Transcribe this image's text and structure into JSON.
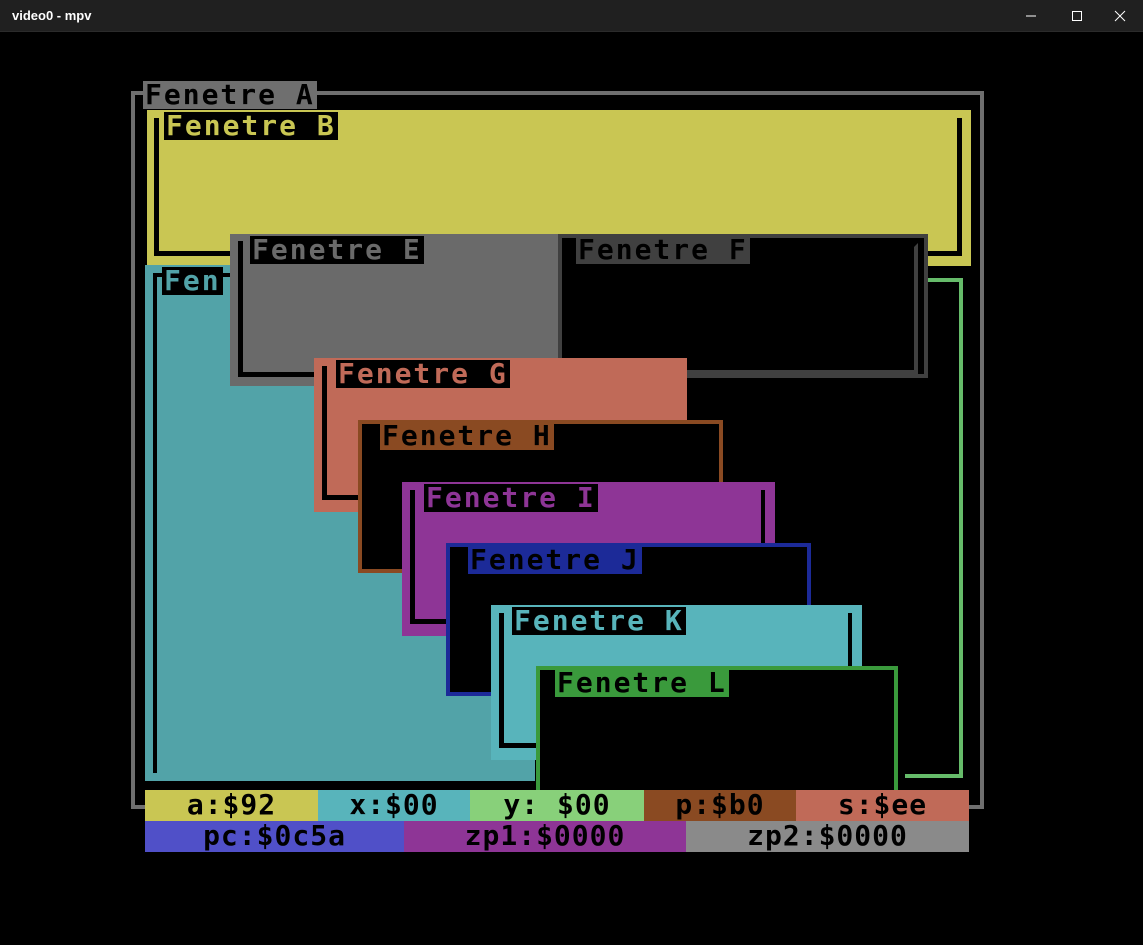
{
  "window": {
    "title": "video0 - mpv"
  },
  "colors": {
    "A": "#6f6f6f",
    "B": "#c9c653",
    "C": "#52a3a8",
    "E": "#6a6a6a",
    "F": "#404040",
    "G": "#c06a58",
    "H": "#8a4a22",
    "I": "#8e3596",
    "J": "#1c2a98",
    "K": "#58b4bb",
    "L": "#3a9a3c",
    "right_green": "#66bb6a"
  },
  "windows": {
    "A": {
      "title": "Fenetre A"
    },
    "B": {
      "title": "Fenetre B"
    },
    "C": {
      "title": "Fen"
    },
    "E": {
      "title": "Fenetre E"
    },
    "F": {
      "title": "Fenetre F"
    },
    "G": {
      "title": "Fenetre G"
    },
    "H": {
      "title": "Fenetre H"
    },
    "I": {
      "title": "Fenetre I"
    },
    "J": {
      "title": "Fenetre J"
    },
    "K": {
      "title": "Fenetre K"
    },
    "L": {
      "title": "Fenetre L"
    }
  },
  "registers": {
    "a": "a:$92",
    "x": "x:$00",
    "y": "y: $00",
    "p": "p:$b0",
    "s": "s:$ee",
    "pc": "pc:$0c5a",
    "zp1": "zp1:$0000",
    "zp2": "zp2:$0000"
  }
}
